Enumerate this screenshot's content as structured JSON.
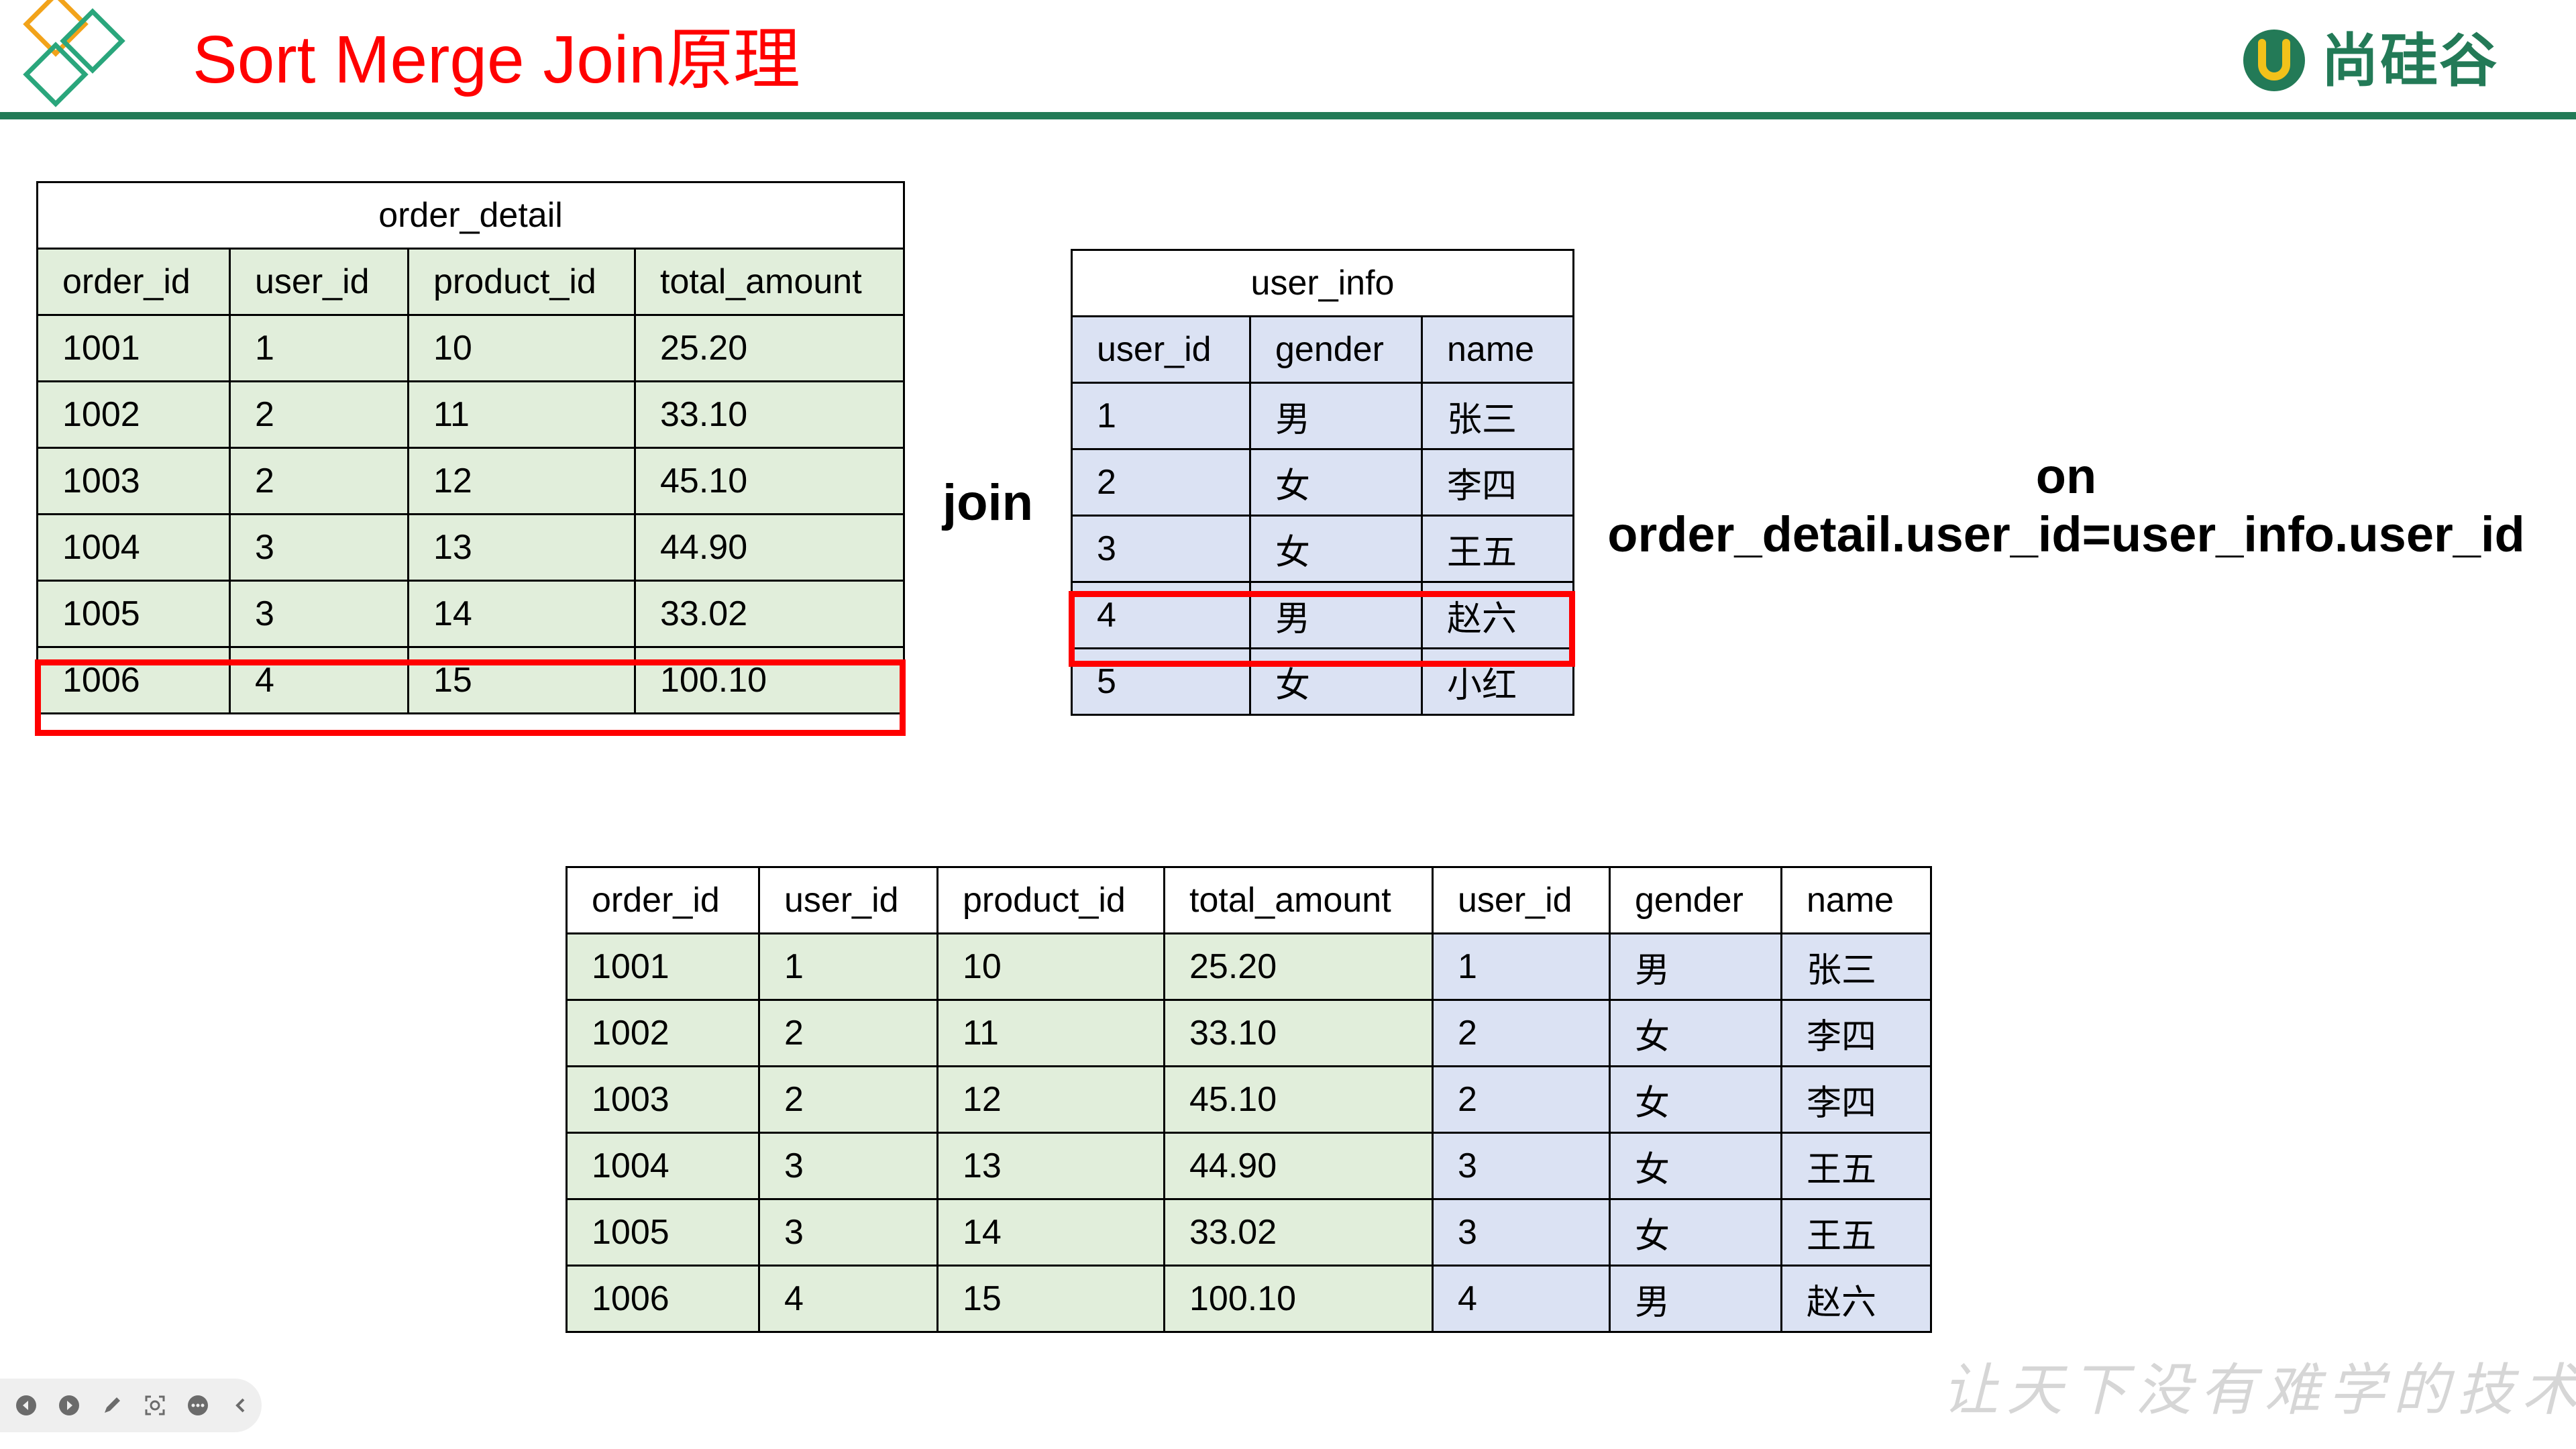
{
  "slide": {
    "title": "Sort Merge Join原理",
    "brand": "尚硅谷",
    "slogan": "让天下没有难学的技术"
  },
  "order_detail": {
    "caption": "order_detail",
    "columns": [
      "order_id",
      "user_id",
      "product_id",
      "total_amount"
    ],
    "rows": [
      [
        "1001",
        "1",
        "10",
        "25.20"
      ],
      [
        "1002",
        "2",
        "11",
        "33.10"
      ],
      [
        "1003",
        "2",
        "12",
        "45.10"
      ],
      [
        "1004",
        "3",
        "13",
        "44.90"
      ],
      [
        "1005",
        "3",
        "14",
        "33.02"
      ],
      [
        "1006",
        "4",
        "15",
        "100.10"
      ]
    ]
  },
  "join_label": "join",
  "user_info": {
    "caption": "user_info",
    "columns": [
      "user_id",
      "gender",
      "name"
    ],
    "rows": [
      [
        "1",
        "男",
        "张三"
      ],
      [
        "2",
        "女",
        "李四"
      ],
      [
        "3",
        "女",
        "王五"
      ],
      [
        "4",
        "男",
        "赵六"
      ],
      [
        "5",
        "女",
        "小红"
      ]
    ]
  },
  "on_clause": {
    "keyword": "on",
    "expression": "order_detail.user_id=user_info.user_id"
  },
  "result": {
    "columns": [
      "order_id",
      "user_id",
      "product_id",
      "total_amount",
      "user_id",
      "gender",
      "name"
    ],
    "rows": [
      [
        "1001",
        "1",
        "10",
        "25.20",
        "1",
        "男",
        "张三"
      ],
      [
        "1002",
        "2",
        "11",
        "33.10",
        "2",
        "女",
        "李四"
      ],
      [
        "1003",
        "2",
        "12",
        "45.10",
        "2",
        "女",
        "李四"
      ],
      [
        "1004",
        "3",
        "13",
        "44.90",
        "3",
        "女",
        "王五"
      ],
      [
        "1005",
        "3",
        "14",
        "33.02",
        "3",
        "女",
        "王五"
      ],
      [
        "1006",
        "4",
        "15",
        "100.10",
        "4",
        "男",
        "赵六"
      ]
    ]
  },
  "colors": {
    "title": "#ff0000",
    "brand": "#237a57",
    "left_table_fill": "#e1eedb",
    "right_table_fill": "#dbe2f3",
    "highlight": "#ff0000"
  },
  "player_controls": [
    "prev-icon",
    "next-icon",
    "pen-icon",
    "fit-screen-icon",
    "more-icon",
    "collapse-icon"
  ]
}
